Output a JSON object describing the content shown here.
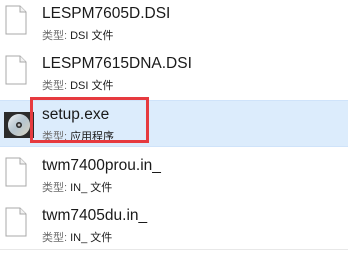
{
  "files": [
    {
      "name": "LESPM7605D.DSI",
      "type_label": "类型:",
      "type_value": "DSI 文件",
      "icon": "document-icon"
    },
    {
      "name": "LESPM7615DNA.DSI",
      "type_label": "类型:",
      "type_value": "DSI 文件",
      "icon": "document-icon"
    },
    {
      "name": "setup.exe",
      "type_label": "类型:",
      "type_value": "应用程序",
      "icon": "disc-icon",
      "selected": true
    },
    {
      "name": "twm7400prou.in_",
      "type_label": "类型:",
      "type_value": "IN_ 文件",
      "icon": "document-icon"
    },
    {
      "name": "twm7405du.in_",
      "type_label": "类型:",
      "type_value": "IN_ 文件",
      "icon": "document-icon"
    }
  ],
  "colors": {
    "highlight": "#e63a3f",
    "selection": "#dcecfc"
  }
}
